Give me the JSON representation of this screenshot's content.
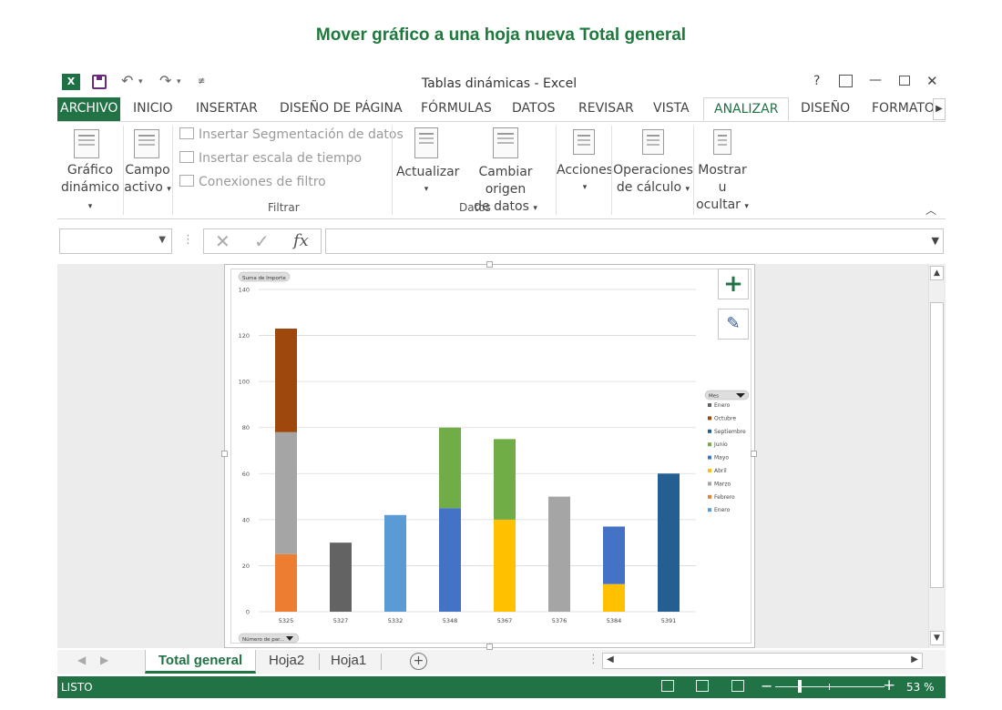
{
  "heading": "Mover gráfico a una hoja nueva Total general",
  "window": {
    "title": "Tablas dinámicas - Excel",
    "app_icon": "X",
    "help": "?",
    "minimize": "—",
    "close": "✕"
  },
  "tabs": [
    {
      "label": "ARCHIVO"
    },
    {
      "label": "INICIO"
    },
    {
      "label": "INSERTAR"
    },
    {
      "label": "DISEÑO DE PÁGINA"
    },
    {
      "label": "FÓRMULAS"
    },
    {
      "label": "DATOS"
    },
    {
      "label": "REVISAR"
    },
    {
      "label": "VISTA"
    },
    {
      "label": "ANALIZAR"
    },
    {
      "label": "DISEÑO"
    },
    {
      "label": "FORMATO"
    }
  ],
  "ribbon": {
    "grafico_dinamico": [
      "Gráfico",
      "dinámico"
    ],
    "campo_activo": [
      "Campo",
      "activo"
    ],
    "filtrar_items": [
      "Insertar Segmentación de datos",
      "Insertar escala de tiempo",
      "Conexiones de filtro"
    ],
    "group_filtrar": "Filtrar",
    "actualizar": "Actualizar",
    "cambiar_origen": [
      "Cambiar origen",
      "de datos"
    ],
    "group_datos": "Datos",
    "acciones": "Acciones",
    "operaciones": [
      "Operaciones",
      "de cálculo"
    ],
    "mostrar": [
      "Mostrar u",
      "ocultar"
    ]
  },
  "formula_bar": {
    "name_box": "",
    "fx": "fx",
    "value": ""
  },
  "sheet_tabs": [
    {
      "label": "Total general",
      "active": true
    },
    {
      "label": "Hoja2",
      "active": false
    },
    {
      "label": "Hoja1",
      "active": false
    }
  ],
  "status": {
    "ready": "LISTO",
    "zoom": "53 %",
    "zoom_level": 53
  },
  "colors": {
    "excel_green": "#217346",
    "heading_green": "#1e7a3c"
  },
  "chart_data": {
    "type": "bar",
    "stacked": true,
    "field_button_value": "Suma de Importe",
    "field_button_axis": "Número de par...",
    "field_button_legend": "Mes",
    "categories": [
      "5325",
      "5327",
      "5332",
      "5348",
      "5367",
      "5376",
      "5384",
      "5391"
    ],
    "ylim": [
      0,
      140
    ],
    "yticks": [
      0,
      20,
      40,
      60,
      80,
      100,
      120,
      140
    ],
    "grid": true,
    "legend_position": "right",
    "series": [
      {
        "name": "Febrero",
        "color": "#ed7d31",
        "values": [
          25,
          0,
          0,
          0,
          0,
          0,
          0,
          0
        ]
      },
      {
        "name": "Marzo",
        "color": "#a5a5a5",
        "values": [
          53,
          0,
          0,
          0,
          0,
          50,
          0,
          0
        ]
      },
      {
        "name": "Octubre",
        "color": "#9e480e",
        "values": [
          45,
          0,
          0,
          0,
          0,
          0,
          0,
          0
        ]
      },
      {
        "name": "Enero",
        "color": "#636363",
        "values": [
          0,
          30,
          0,
          0,
          0,
          0,
          0,
          0
        ]
      },
      {
        "name": "Enero",
        "color": "#5b9bd5",
        "values": [
          0,
          0,
          42,
          0,
          0,
          0,
          0,
          0
        ]
      },
      {
        "name": "Abril",
        "color": "#ffc000",
        "values": [
          0,
          0,
          0,
          0,
          40,
          0,
          12,
          0
        ]
      },
      {
        "name": "Mayo",
        "color": "#4472c4",
        "values": [
          0,
          0,
          0,
          45,
          0,
          0,
          25,
          0
        ]
      },
      {
        "name": "Junio",
        "color": "#70ad47",
        "values": [
          0,
          0,
          0,
          35,
          35,
          0,
          0,
          0
        ]
      },
      {
        "name": "Septiembre",
        "color": "#255e91",
        "values": [
          0,
          0,
          0,
          0,
          0,
          0,
          0,
          60
        ]
      }
    ],
    "legend": [
      {
        "name": "Enero",
        "color": "#636363"
      },
      {
        "name": "Octubre",
        "color": "#9e480e"
      },
      {
        "name": "Septiembre",
        "color": "#255e91"
      },
      {
        "name": "Junio",
        "color": "#70ad47"
      },
      {
        "name": "Mayo",
        "color": "#4472c4"
      },
      {
        "name": "Abril",
        "color": "#ffc000"
      },
      {
        "name": "Marzo",
        "color": "#a5a5a5"
      },
      {
        "name": "Febrero",
        "color": "#ed7d31"
      },
      {
        "name": "Enero",
        "color": "#5b9bd5"
      }
    ]
  }
}
